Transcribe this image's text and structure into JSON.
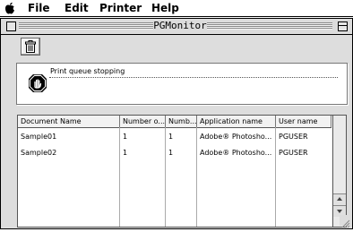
{
  "menubar": {
    "apple_icon": "apple-logo-icon",
    "items": [
      {
        "label": "File"
      },
      {
        "label": "Edit"
      },
      {
        "label": "Printer"
      },
      {
        "label": "Help"
      }
    ]
  },
  "window": {
    "title": "PGMonitor",
    "close_icon": "close-box-icon",
    "zoom_icon": "zoom-box-icon",
    "toolbar": {
      "delete_icon": "trash-icon"
    },
    "status": {
      "icon": "stop-hand-icon",
      "text": "Print queue stopping"
    },
    "table": {
      "columns": [
        "Document Name",
        "Number o...",
        "Numb...",
        "Application name",
        "User name"
      ],
      "rows": [
        {
          "document": "Sample01",
          "number_of": "1",
          "numb": "1",
          "application": "Adobe® Photosho...",
          "user": "PGUSER"
        },
        {
          "document": "Sample02",
          "number_of": "1",
          "numb": "1",
          "application": "Adobe® Photosho...",
          "user": "PGUSER"
        }
      ]
    }
  },
  "colors": {
    "window_bg": "#dddddd",
    "panel_bg": "#ffffff",
    "border": "#000000"
  }
}
